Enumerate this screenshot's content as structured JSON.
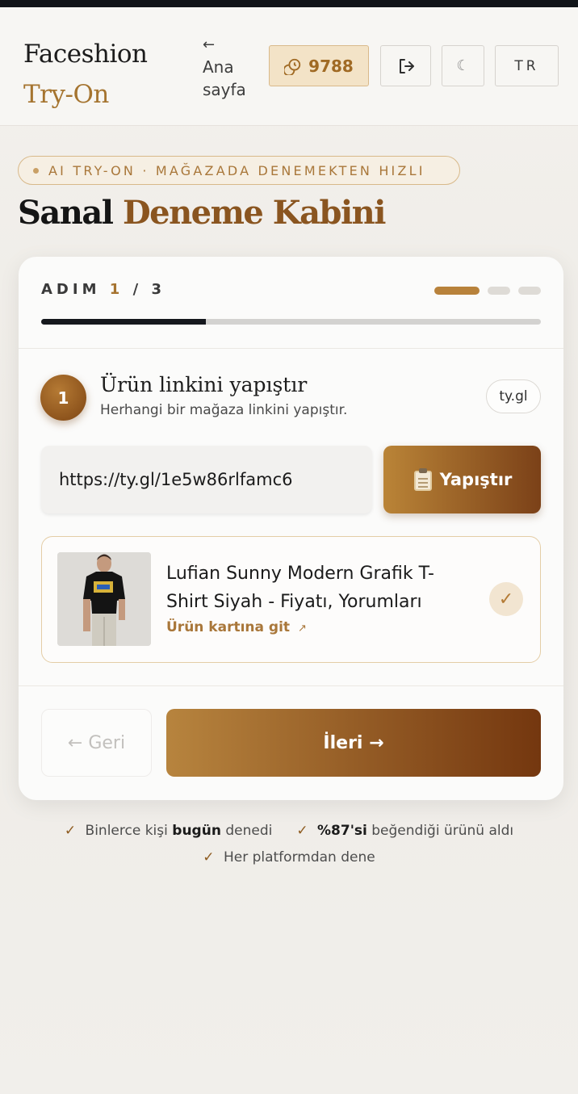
{
  "header": {
    "brand_main": "Faceshion",
    "brand_accent": "Try-On",
    "home_arrow": "←",
    "home_label": "Ana sayfa",
    "credits": "9788",
    "lang": "TR"
  },
  "hero": {
    "pill": "AI TRY-ON · MAĞAZADA DENEMEKTEN HIZLI",
    "title_main": "Sanal",
    "title_accent": "Deneme Kabini"
  },
  "stepper": {
    "label": "ADIM",
    "current": "1",
    "separator": "/",
    "total": "3",
    "progress": 0.33
  },
  "step": {
    "number": "1",
    "title": "Ürün linkini yapıştır",
    "subtitle": "Herhangi bir mağaza linkini yapıştır.",
    "domain_badge": "ty.gl",
    "url_value": "https://ty.gl/1e5w86rlfamc6",
    "paste_label": "Yapıştır"
  },
  "product": {
    "title": "Lufian Sunny Modern Grafik T-Shirt Siyah - Fiyatı, Yorumları",
    "link_label": "Ürün kartına git",
    "link_icon": "↗",
    "check": "✓"
  },
  "nav": {
    "back_label": "← Geri",
    "next_label": "İleri →"
  },
  "trust": {
    "item1_pre": "Binlerce kişi",
    "item1_bold": "bugün",
    "item1_post": "denedi",
    "item2_bold": "%87'si",
    "item2_post": "beğendiği ürünü aldı",
    "item3": "Her platformdan dene",
    "tick": "✓"
  },
  "colors": {
    "accent": "#a5742f",
    "accent_dark": "#7b4118",
    "progress_fill": "#15181d"
  }
}
